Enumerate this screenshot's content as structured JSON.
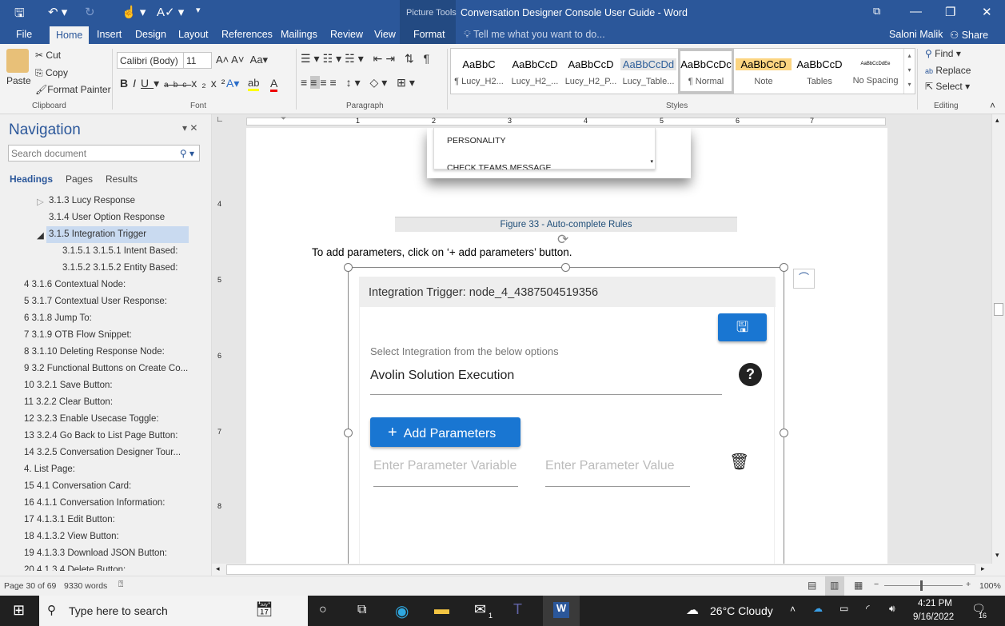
{
  "window": {
    "title": "Conversation Designer Console User Guide - Word",
    "context_tab": "Picture Tools",
    "user": "Saloni Malik",
    "share": "Share"
  },
  "tabs": [
    "File",
    "Home",
    "Insert",
    "Design",
    "Layout",
    "References",
    "Mailings",
    "Review",
    "View",
    "Format"
  ],
  "tell_me": "Tell me what you want to do...",
  "clipboard": {
    "paste": "Paste",
    "cut": "Cut",
    "copy": "Copy",
    "format_painter": "Format Painter",
    "group": "Clipboard"
  },
  "font": {
    "name": "Calibri (Body)",
    "size": "11",
    "group": "Font"
  },
  "paragraph": {
    "group": "Paragraph"
  },
  "styles": {
    "group": "Styles",
    "items": [
      {
        "preview": "AaBbC",
        "name": "¶ Lucy_H2..."
      },
      {
        "preview": "AaBbCcD",
        "name": "Lucy_H2_..."
      },
      {
        "preview": "AaBbCcD",
        "name": "Lucy_H2_P..."
      },
      {
        "preview": "AaBbCcDd",
        "name": "Lucy_Table..."
      },
      {
        "preview": "AaBbCcDc",
        "name": "¶ Normal"
      },
      {
        "preview": "AaBbCcD",
        "name": "Note"
      },
      {
        "preview": "AaBbCcD",
        "name": "Tables"
      },
      {
        "preview": "AaBbCcDdEe",
        "name": "No Spacing"
      }
    ]
  },
  "editing": {
    "find": "Find",
    "replace": "Replace",
    "select": "Select",
    "group": "Editing"
  },
  "navigation": {
    "title": "Navigation",
    "search_placeholder": "Search document",
    "tabs": [
      "Headings",
      "Pages",
      "Results"
    ],
    "items": [
      "3.1.3 Lucy Response",
      "3.1.4  User Option Response",
      "3.1.5 Integration Trigger",
      "3.1.5.1 3.1.5.1 Intent Based:",
      "3.1.5.2 3.1.5.2 Entity Based:",
      "4 3.1.6 Contextual Node:",
      "5 3.1.7 Contextual User Response:",
      "6 3.1.8 Jump To:",
      "7 3.1.9 OTB Flow Snippet:",
      "8 3.1.10 Deleting Response Node:",
      "9 3.2 Functional Buttons on Create Co...",
      "10 3.2.1 Save Button:",
      "11 3.2.2 Clear Button:",
      "12 3.2.3 Enable Usecase Toggle:",
      "13 3.2.4 Go Back to List Page Button:",
      "14 3.2.5 Conversation Designer Tour...",
      "4. List Page:",
      "15 4.1 Conversation Card:",
      "16 4.1.1 Conversation Information:",
      "17 4.1.3.1 Edit Button:",
      "18 4.1.3.2 View Button:",
      "19 4.1.3.3 Download JSON Button:",
      "20 4.1.3.4 Delete Button:"
    ]
  },
  "ruler": {
    "h": [
      "1",
      "2",
      "3",
      "4",
      "5",
      "6",
      "7"
    ],
    "v": [
      "4",
      "5",
      "6",
      "7",
      "8"
    ]
  },
  "document": {
    "list_items": [
      "PERSONALITY",
      "CHECK TEAMS MESSAGE"
    ],
    "caption": "Figure 33 - Auto-complete Rules",
    "paragraph": "To add parameters, click on ‘+ add parameters’ button.",
    "card": {
      "title": "Integration Trigger: node_4_4387504519356",
      "select_label": "Select Integration from the below options",
      "select_value": "Avolin Solution Execution",
      "add_button": "Add Parameters",
      "var_placeholder": "Enter Parameter Variable",
      "val_placeholder": "Enter Parameter Value"
    }
  },
  "status": {
    "page": "Page 30 of 69",
    "words": "9330 words",
    "zoom": "100%"
  },
  "taskbar": {
    "search": "Type here to search",
    "weather": "26°C  Cloudy",
    "time": "4:21 PM",
    "date": "9/16/2022",
    "notifications": "16",
    "mail_badge": "1"
  },
  "colors": {
    "word_blue": "#2b579a",
    "button_blue": "#1976d2",
    "caption": "#1f4e79"
  }
}
